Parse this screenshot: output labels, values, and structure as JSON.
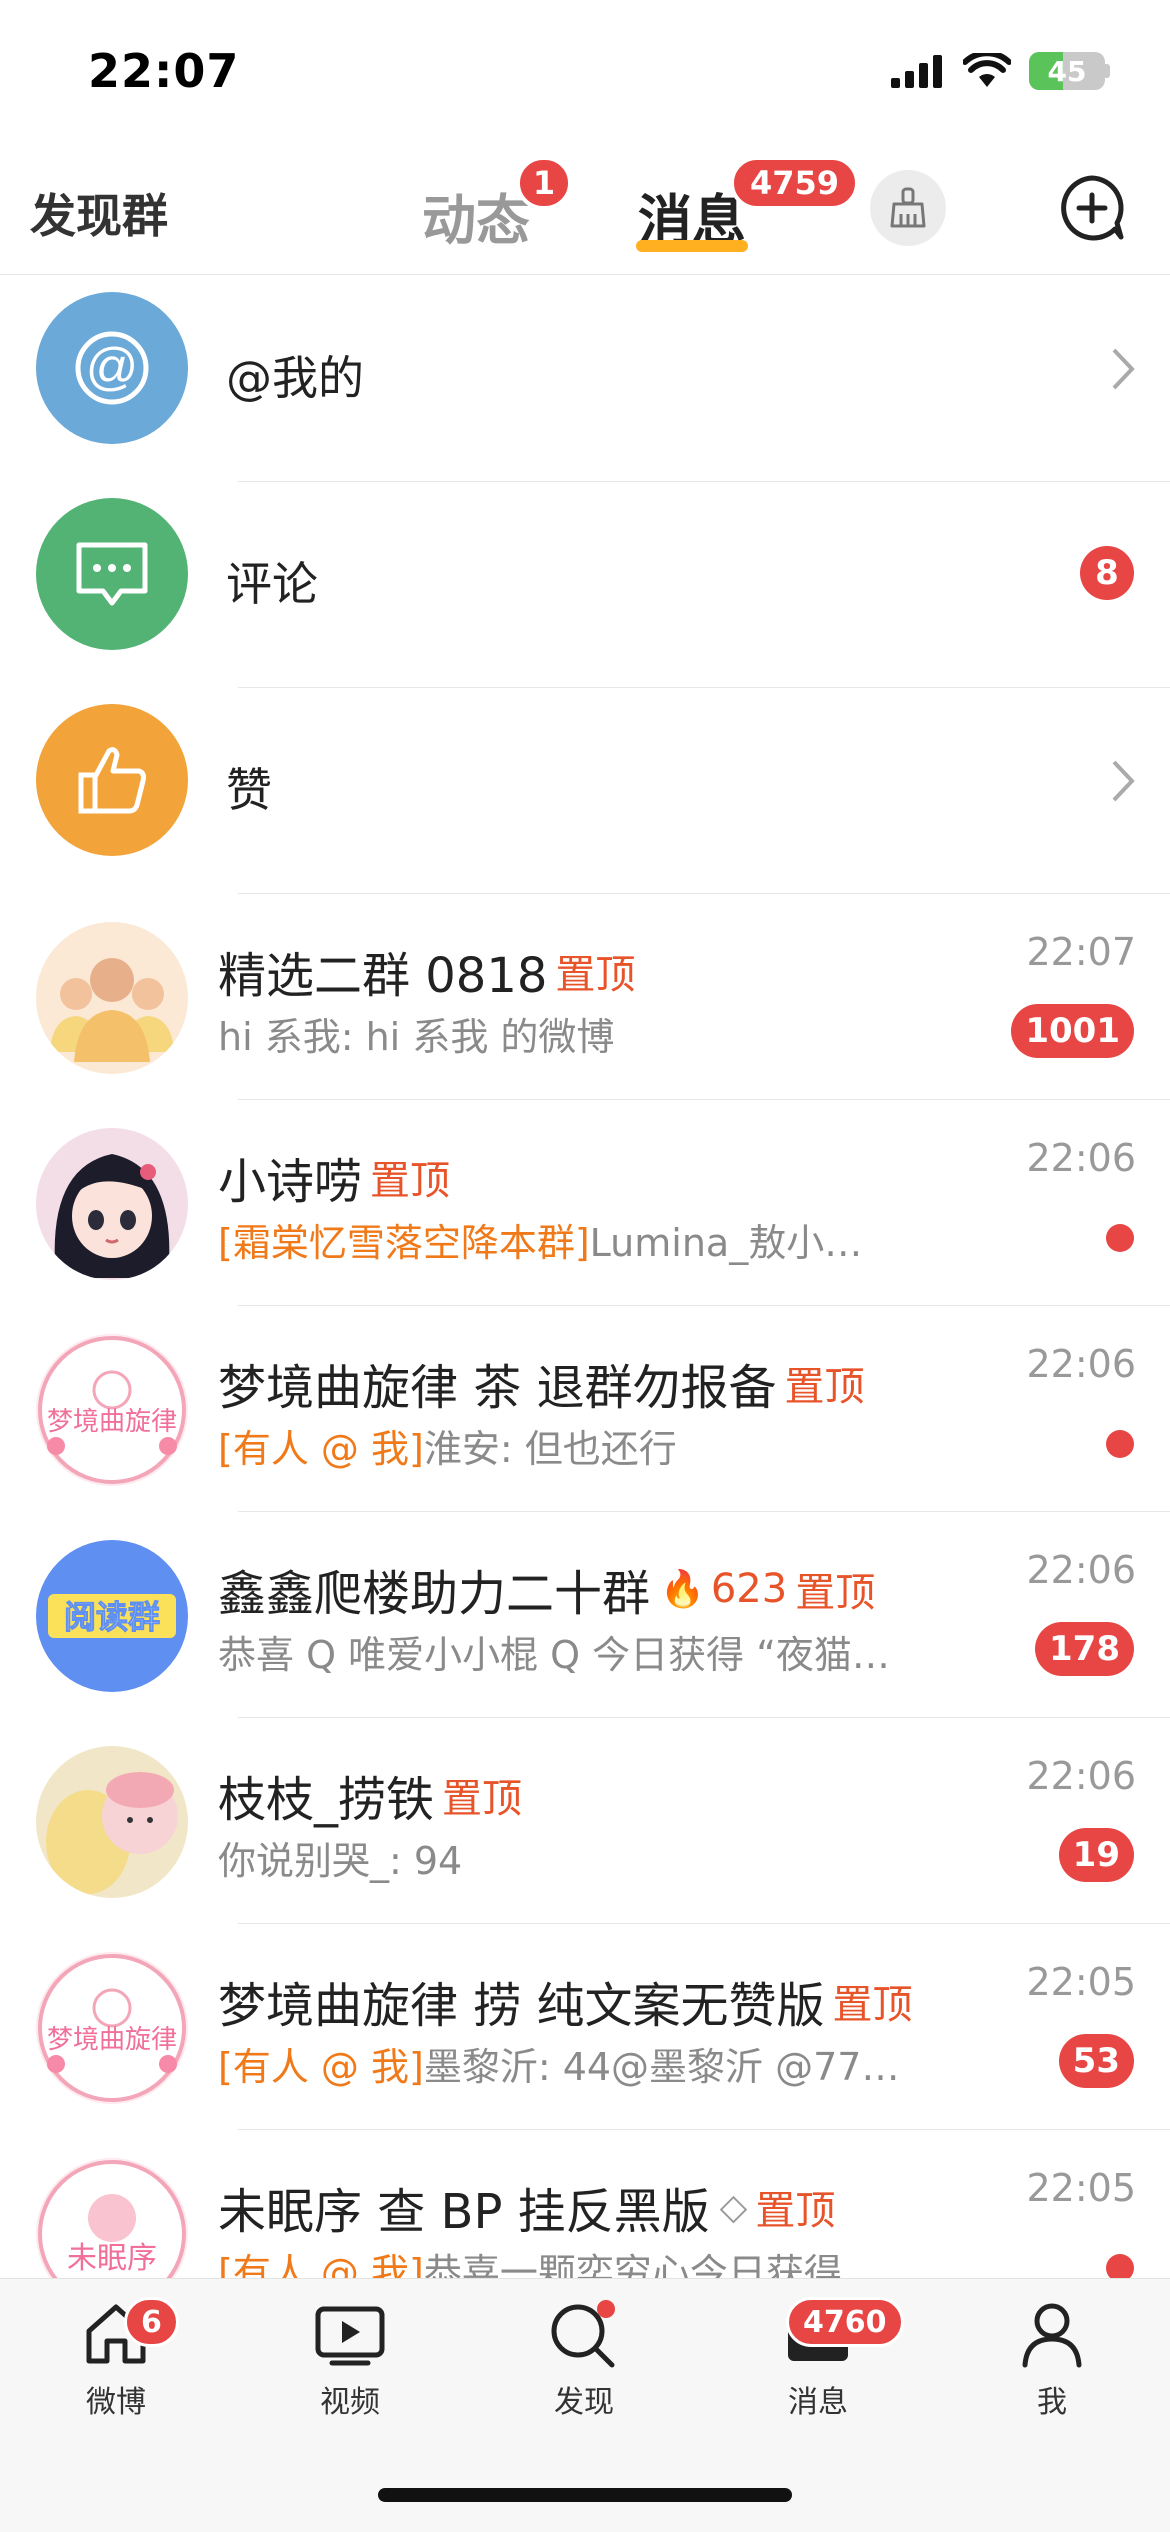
{
  "status": {
    "time": "22:07",
    "battery": "45",
    "battery_level": 0.45
  },
  "nav": {
    "left": "发现群",
    "tab_dynamic": "动态",
    "tab_dynamic_badge": "1",
    "tab_message": "消息",
    "tab_message_badge": "4759"
  },
  "system_rows": [
    {
      "label": "@我的",
      "color": "#6aa9d8"
    },
    {
      "label": "评论",
      "color": "#52b374",
      "badge": "8"
    },
    {
      "label": "赞",
      "color": "#f2a33a"
    }
  ],
  "chats": [
    {
      "title": "精选二群 0818",
      "pin": "置顶",
      "time": "22:07",
      "preview": "hi 系我: hi 系我 的微博",
      "badge": "1001"
    },
    {
      "title": "小诗唠",
      "pin": "置顶",
      "time": "22:06",
      "tag": "[霜棠忆雪落空降本群]",
      "preview": "Lumina_敖小…"
    },
    {
      "title": "梦境曲旋律 茶 退群勿报备",
      "pin": "置顶",
      "time": "22:06",
      "tag": "[有人 @ 我]",
      "preview": "淮安: 但也还行"
    },
    {
      "title": "鑫鑫爬楼助力二十群",
      "hot": "623",
      "pin": "置顶",
      "time": "22:06",
      "preview": "恭喜 Q 唯爱小小棍 Q 今日获得 “夜猫…",
      "badge": "178"
    },
    {
      "title": "枝枝_捞铁",
      "pin": "置顶",
      "time": "22:06",
      "preview": "你说别哭_: 94",
      "badge": "19"
    },
    {
      "title": "梦境曲旋律 捞 纯文案无赞版",
      "pin": "置顶",
      "time": "22:05",
      "tag": "[有人 @ 我]",
      "preview": "墨黎沂: 44@墨黎沂 @77…",
      "badge": "53"
    },
    {
      "title": "未眠序 查 BP 挂反黑版",
      "pin": "置顶",
      "time": "22:05",
      "tag": "[有人 @ 我]",
      "preview": "恭喜一颗奕穷心今日获得"
    }
  ],
  "avatars": {
    "group1": "阅读群",
    "dream": "梦境曲旋律",
    "night": "未眠序"
  },
  "tabbar": [
    {
      "label": "微博",
      "badge": "6"
    },
    {
      "label": "视频"
    },
    {
      "label": "发现"
    },
    {
      "label": "消息",
      "badge": "4760"
    },
    {
      "label": "我"
    }
  ]
}
